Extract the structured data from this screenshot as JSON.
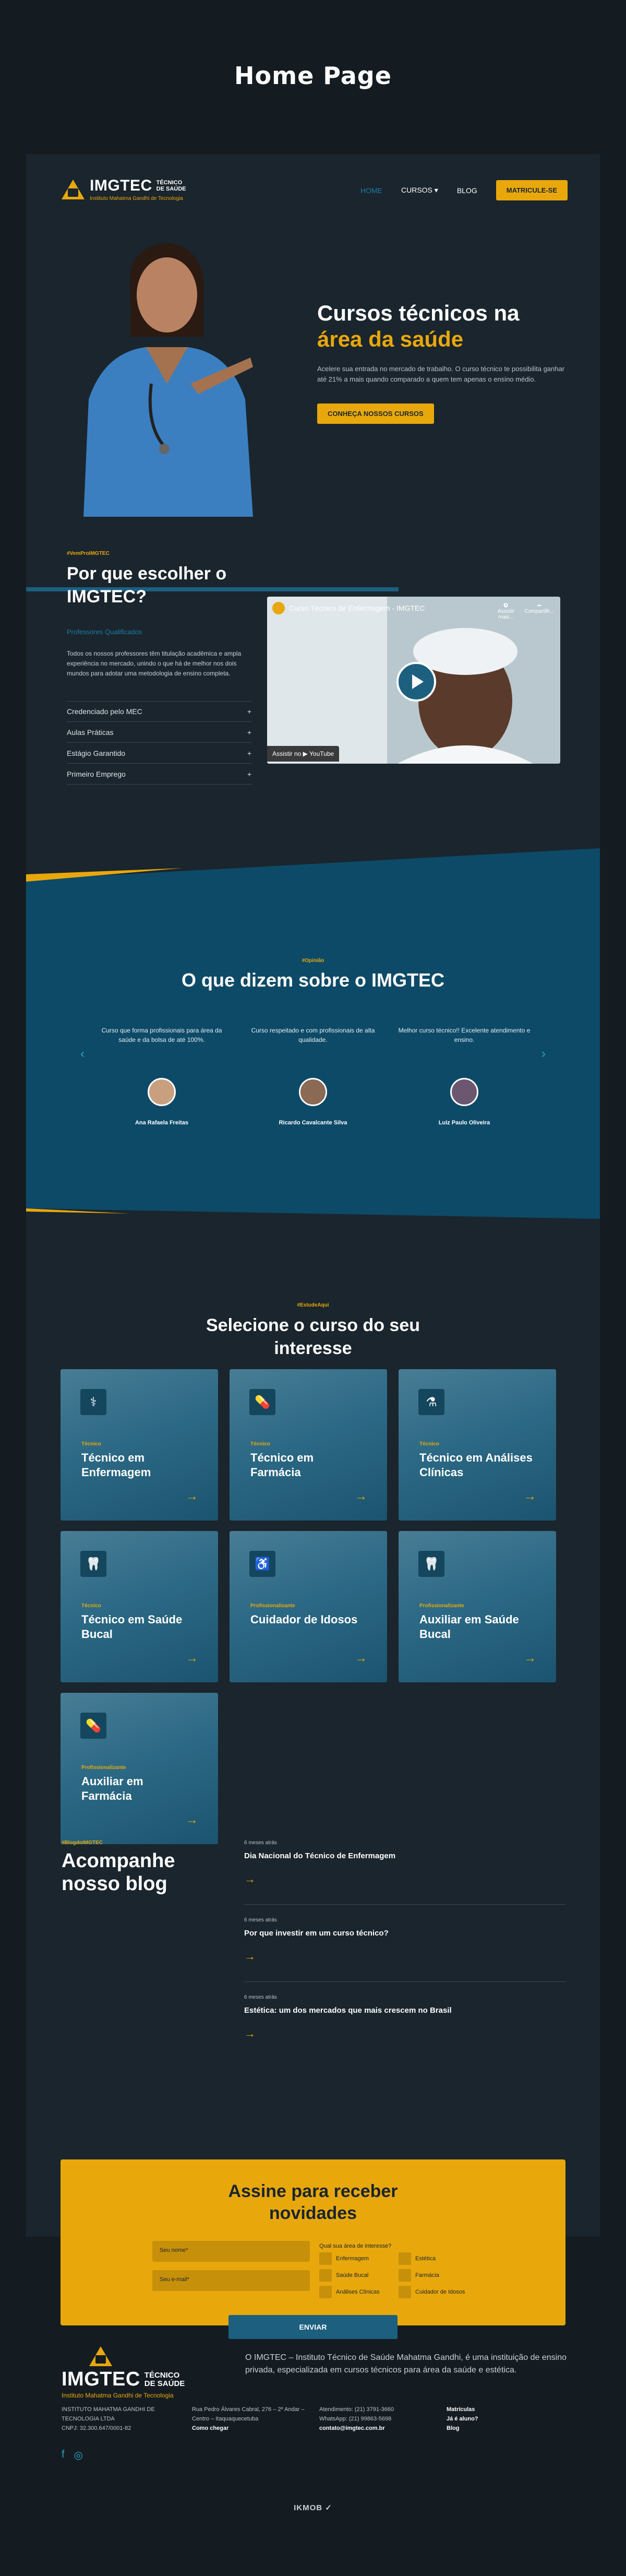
{
  "page_label": "Home Page",
  "brand": {
    "name": "IMGTEC",
    "sub_line1": "TÉCNICO",
    "sub_line2": "DE SAÚDE",
    "tagline": "Instituto Mahatma Gandhi de Tecnologia"
  },
  "nav": {
    "items": [
      {
        "label": "HOME",
        "active": true
      },
      {
        "label": "CURSOS ▾",
        "active": false
      },
      {
        "label": "BLOG",
        "active": false
      }
    ],
    "cta": "MATRICULE-SE"
  },
  "hero": {
    "title_line1": "Cursos técnicos na",
    "title_line2": "área da saúde",
    "text": "Acelere sua entrada no mercado de trabalho. O curso técnico te possibilita ganhar até 21% a mais quando comparado a quem tem apenas o ensino médio.",
    "button": "CONHEÇA NOSSOS CURSOS"
  },
  "why": {
    "tag": "#VemProIMGTEC",
    "title": "Por que escolher o IMGTEC?",
    "link": "Professores Qualificados",
    "text": "Todos os nossos professores têm titulação acadêmica e ampla experiência no mercado, unindo o que há de melhor nos dois mundos para adotar uma metodologia de ensino completa.",
    "accordion": [
      {
        "label": "Credenciado pelo MEC",
        "icon": "+"
      },
      {
        "label": "Aulas Práticas",
        "icon": "+"
      },
      {
        "label": "Estágio Garantido",
        "icon": "+"
      },
      {
        "label": "Primeiro Emprego",
        "icon": "+"
      }
    ],
    "video": {
      "title": "Curso Técnico de Enfermagem - IMGTEC",
      "watch_later": "Assistir mais...",
      "share": "Compartilh...",
      "watch_on": "Assistir no ▶ YouTube"
    }
  },
  "testimonials": {
    "tag": "#Opinião",
    "title": "O que dizem sobre o IMGTEC",
    "items": [
      {
        "quote": "Curso que forma profissionais para área da saúde e da bolsa de até 100%.",
        "name": "Ana Rafaela Freitas"
      },
      {
        "quote": "Curso respeitado e com profissionais de alta qualidade.",
        "name": "Ricardo Cavalcante Silva"
      },
      {
        "quote": "Melhor curso técnico!! Excelente atendimento e ensino.",
        "name": "Luiz Paulo Oliveira"
      }
    ],
    "prev": "‹",
    "next": "›"
  },
  "courses": {
    "tag": "#EstudeAqui",
    "title": "Selecione o curso do seu interesse",
    "items": [
      {
        "tag": "Técnico",
        "name": "Técnico em Enfermagem",
        "icon": "stethoscope-icon",
        "glyph": "⚕"
      },
      {
        "tag": "Técnico",
        "name": "Técnico em Farmácia",
        "icon": "medicine-icon",
        "glyph": "💊"
      },
      {
        "tag": "Técnico",
        "name": "Técnico em Análises Clínicas",
        "icon": "dna-icon",
        "glyph": "⚗"
      },
      {
        "tag": "Técnico",
        "name": "Técnico em Saúde Bucal",
        "icon": "tooth-icon",
        "glyph": "🦷"
      },
      {
        "tag": "Profissionalizante",
        "name": "Cuidador de Idosos",
        "icon": "elderly-icon",
        "glyph": "♿"
      },
      {
        "tag": "Profissionalizante",
        "name": "Auxiliar em Saúde Bucal",
        "icon": "tooth-icon",
        "glyph": "🦷"
      },
      {
        "tag": "Profissionalizante",
        "name": "Auxiliar em Farmácia",
        "icon": "pill-icon",
        "glyph": "💊"
      }
    ],
    "arrow": "→"
  },
  "blog": {
    "tag": "#BlogdoIMGTEC",
    "title": "Acompanhe nosso blog",
    "posts": [
      {
        "date": "6 meses atrás",
        "title": "Dia Nacional do Técnico de Enfermagem"
      },
      {
        "date": "6 meses atrás",
        "title": "Por que investir em um curso técnico?"
      },
      {
        "date": "6 meses atrás",
        "title": "Estética: um dos mercados que mais crescem no Brasil"
      }
    ],
    "arrow": "→"
  },
  "newsletter": {
    "title": "Assine para receber novidades",
    "name_placeholder": "Seu nome*",
    "email_placeholder": "Seu e-mail*",
    "interest_label": "Qual sua área de interesse?",
    "options": [
      "Enfermagem",
      "Estética",
      "Saúde Bucal",
      "Farmácia",
      "Análises Clínicas",
      "Cuidador de Idosos"
    ],
    "button": "ENVIAR"
  },
  "footer": {
    "about": "O IMGTEC – Instituto Técnico de Saúde Mahatma Gandhi, é uma instituição de ensino privada, especializada em cursos técnicos para área da saúde e estética.",
    "col1": [
      "INSTITUTO MAHATMA GANDHI DE",
      "TECNOLOGIA LTDA",
      "CNPJ: 32.300.647/0001-82"
    ],
    "col2": [
      "Rua Pedro Álvares Cabral, 276 – 2º Andar –",
      "Centro – Itaquaquecetuba",
      "Como chegar"
    ],
    "col3": [
      "Atendimento: (21) 3791-3660",
      "WhatsApp: (21) 99863-5698",
      "contato@imgtec.com.br"
    ],
    "col4": [
      "Matrículas",
      "Já é aluno?",
      "Blog"
    ],
    "social": [
      "f",
      "◎"
    ],
    "credit": "IKMOB"
  }
}
